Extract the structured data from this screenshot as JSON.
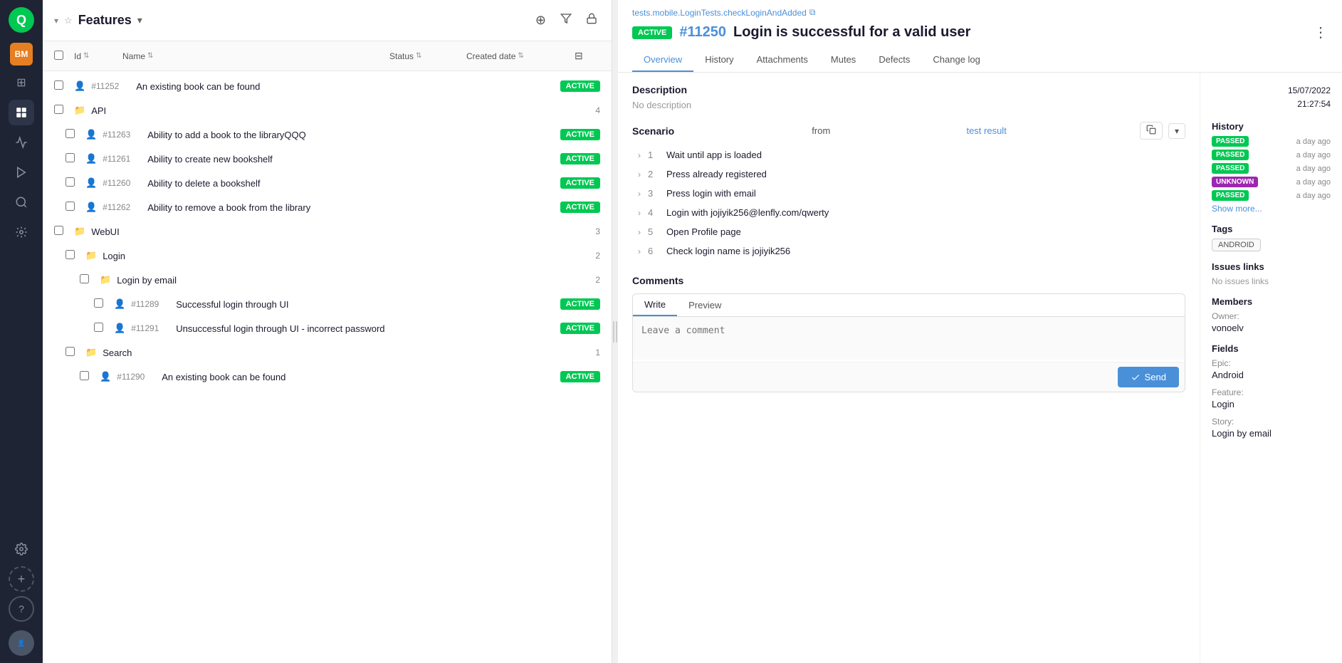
{
  "app": {
    "logo": "Q",
    "bm_label": "BM"
  },
  "nav": {
    "items": [
      {
        "name": "dashboard-icon",
        "icon": "⊞",
        "active": false
      },
      {
        "name": "tests-icon",
        "icon": "◫",
        "active": true
      },
      {
        "name": "analytics-icon",
        "icon": "◱",
        "active": false
      },
      {
        "name": "launch-icon",
        "icon": "⚡",
        "active": false
      },
      {
        "name": "search-icon",
        "icon": "⌕",
        "active": false
      },
      {
        "name": "integrations-icon",
        "icon": "⊙",
        "active": false
      },
      {
        "name": "settings-icon",
        "icon": "⚙",
        "active": false
      }
    ]
  },
  "feature_panel": {
    "title": "Features",
    "add_label": "+",
    "filter_label": "⊘",
    "lock_label": "🔒"
  },
  "table_header": {
    "id_label": "Id",
    "name_label": "Name",
    "status_label": "Status",
    "date_label": "Created date"
  },
  "rows": [
    {
      "type": "item",
      "indent": 0,
      "id": "#11252",
      "name": "An existing book can be found",
      "status": "ACTIVE",
      "count": null
    },
    {
      "type": "group",
      "indent": 0,
      "id": null,
      "name": "API",
      "status": null,
      "count": 4
    },
    {
      "type": "item",
      "indent": 1,
      "id": "#11263",
      "name": "Ability to add a book to the libraryQQQ",
      "status": "ACTIVE",
      "count": null
    },
    {
      "type": "item",
      "indent": 1,
      "id": "#11261",
      "name": "Ability to create new bookshelf",
      "status": "ACTIVE",
      "count": null
    },
    {
      "type": "item",
      "indent": 1,
      "id": "#11260",
      "name": "Ability to delete a bookshelf",
      "status": "ACTIVE",
      "count": null
    },
    {
      "type": "item",
      "indent": 1,
      "id": "#11262",
      "name": "Ability to remove a book from the library",
      "status": "ACTIVE",
      "count": null
    },
    {
      "type": "group",
      "indent": 0,
      "id": null,
      "name": "WebUI",
      "status": null,
      "count": 3
    },
    {
      "type": "group",
      "indent": 1,
      "id": null,
      "name": "Login",
      "status": null,
      "count": 2
    },
    {
      "type": "group",
      "indent": 2,
      "id": null,
      "name": "Login by email",
      "status": null,
      "count": 2
    },
    {
      "type": "item",
      "indent": 3,
      "id": "#11289",
      "name": "Successful login through UI",
      "status": "ACTIVE",
      "count": null
    },
    {
      "type": "item",
      "indent": 3,
      "id": "#11291",
      "name": "Unsuccessful login through UI - incorrect password",
      "status": "ACTIVE",
      "count": null
    },
    {
      "type": "group",
      "indent": 1,
      "id": null,
      "name": "Search",
      "status": null,
      "count": 1
    },
    {
      "type": "item",
      "indent": 2,
      "id": "#11290",
      "name": "An existing book can be found",
      "status": "ACTIVE",
      "count": null
    }
  ],
  "detail": {
    "path": "tests.mobile.LoginTests.checkLoginAndAdded",
    "status": "ACTIVE",
    "test_id": "#11250",
    "title": "Login is successful for a valid user",
    "tabs": [
      "Overview",
      "History",
      "Attachments",
      "Mutes",
      "Defects",
      "Change log"
    ],
    "active_tab": "Overview",
    "description_title": "Description",
    "description_text": "No description",
    "scenario_title": "Scenario",
    "scenario_from": "from",
    "scenario_link": "test result",
    "steps": [
      {
        "num": 1,
        "text": "Wait until app is loaded"
      },
      {
        "num": 2,
        "text": "Press already registered"
      },
      {
        "num": 3,
        "text": "Press login with email"
      },
      {
        "num": 4,
        "text": "Login with jojiyik256@lenfly.com/qwerty"
      },
      {
        "num": 5,
        "text": "Open Profile page"
      },
      {
        "num": 6,
        "text": "Check login name is jojiyik256"
      }
    ],
    "comments_title": "Comments",
    "write_tab": "Write",
    "preview_tab": "Preview",
    "comment_placeholder": "Leave a comment",
    "send_label": "Send",
    "date": "15/07/2022",
    "time": "21:27:54",
    "history_title": "History",
    "history_items": [
      {
        "status": "PASSED",
        "badge_type": "passed",
        "time": "a day ago"
      },
      {
        "status": "PASSED",
        "badge_type": "passed",
        "time": "a day ago"
      },
      {
        "status": "PASSED",
        "badge_type": "passed",
        "time": "a day ago"
      },
      {
        "status": "UNKNOWN",
        "badge_type": "unknown",
        "time": "a day ago"
      },
      {
        "status": "PASSED",
        "badge_type": "passed",
        "time": "a day ago"
      }
    ],
    "show_more": "Show more...",
    "tags_title": "Tags",
    "tags": [
      "ANDROID"
    ],
    "issues_title": "Issues links",
    "no_issues": "No issues links",
    "members_title": "Members",
    "owner_label": "Owner:",
    "owner_value": "vonoelv",
    "fields_title": "Fields",
    "epic_label": "Epic:",
    "epic_value": "Android",
    "feature_label": "Feature:",
    "feature_value": "Login",
    "story_label": "Story:",
    "story_value": "Login by email"
  }
}
